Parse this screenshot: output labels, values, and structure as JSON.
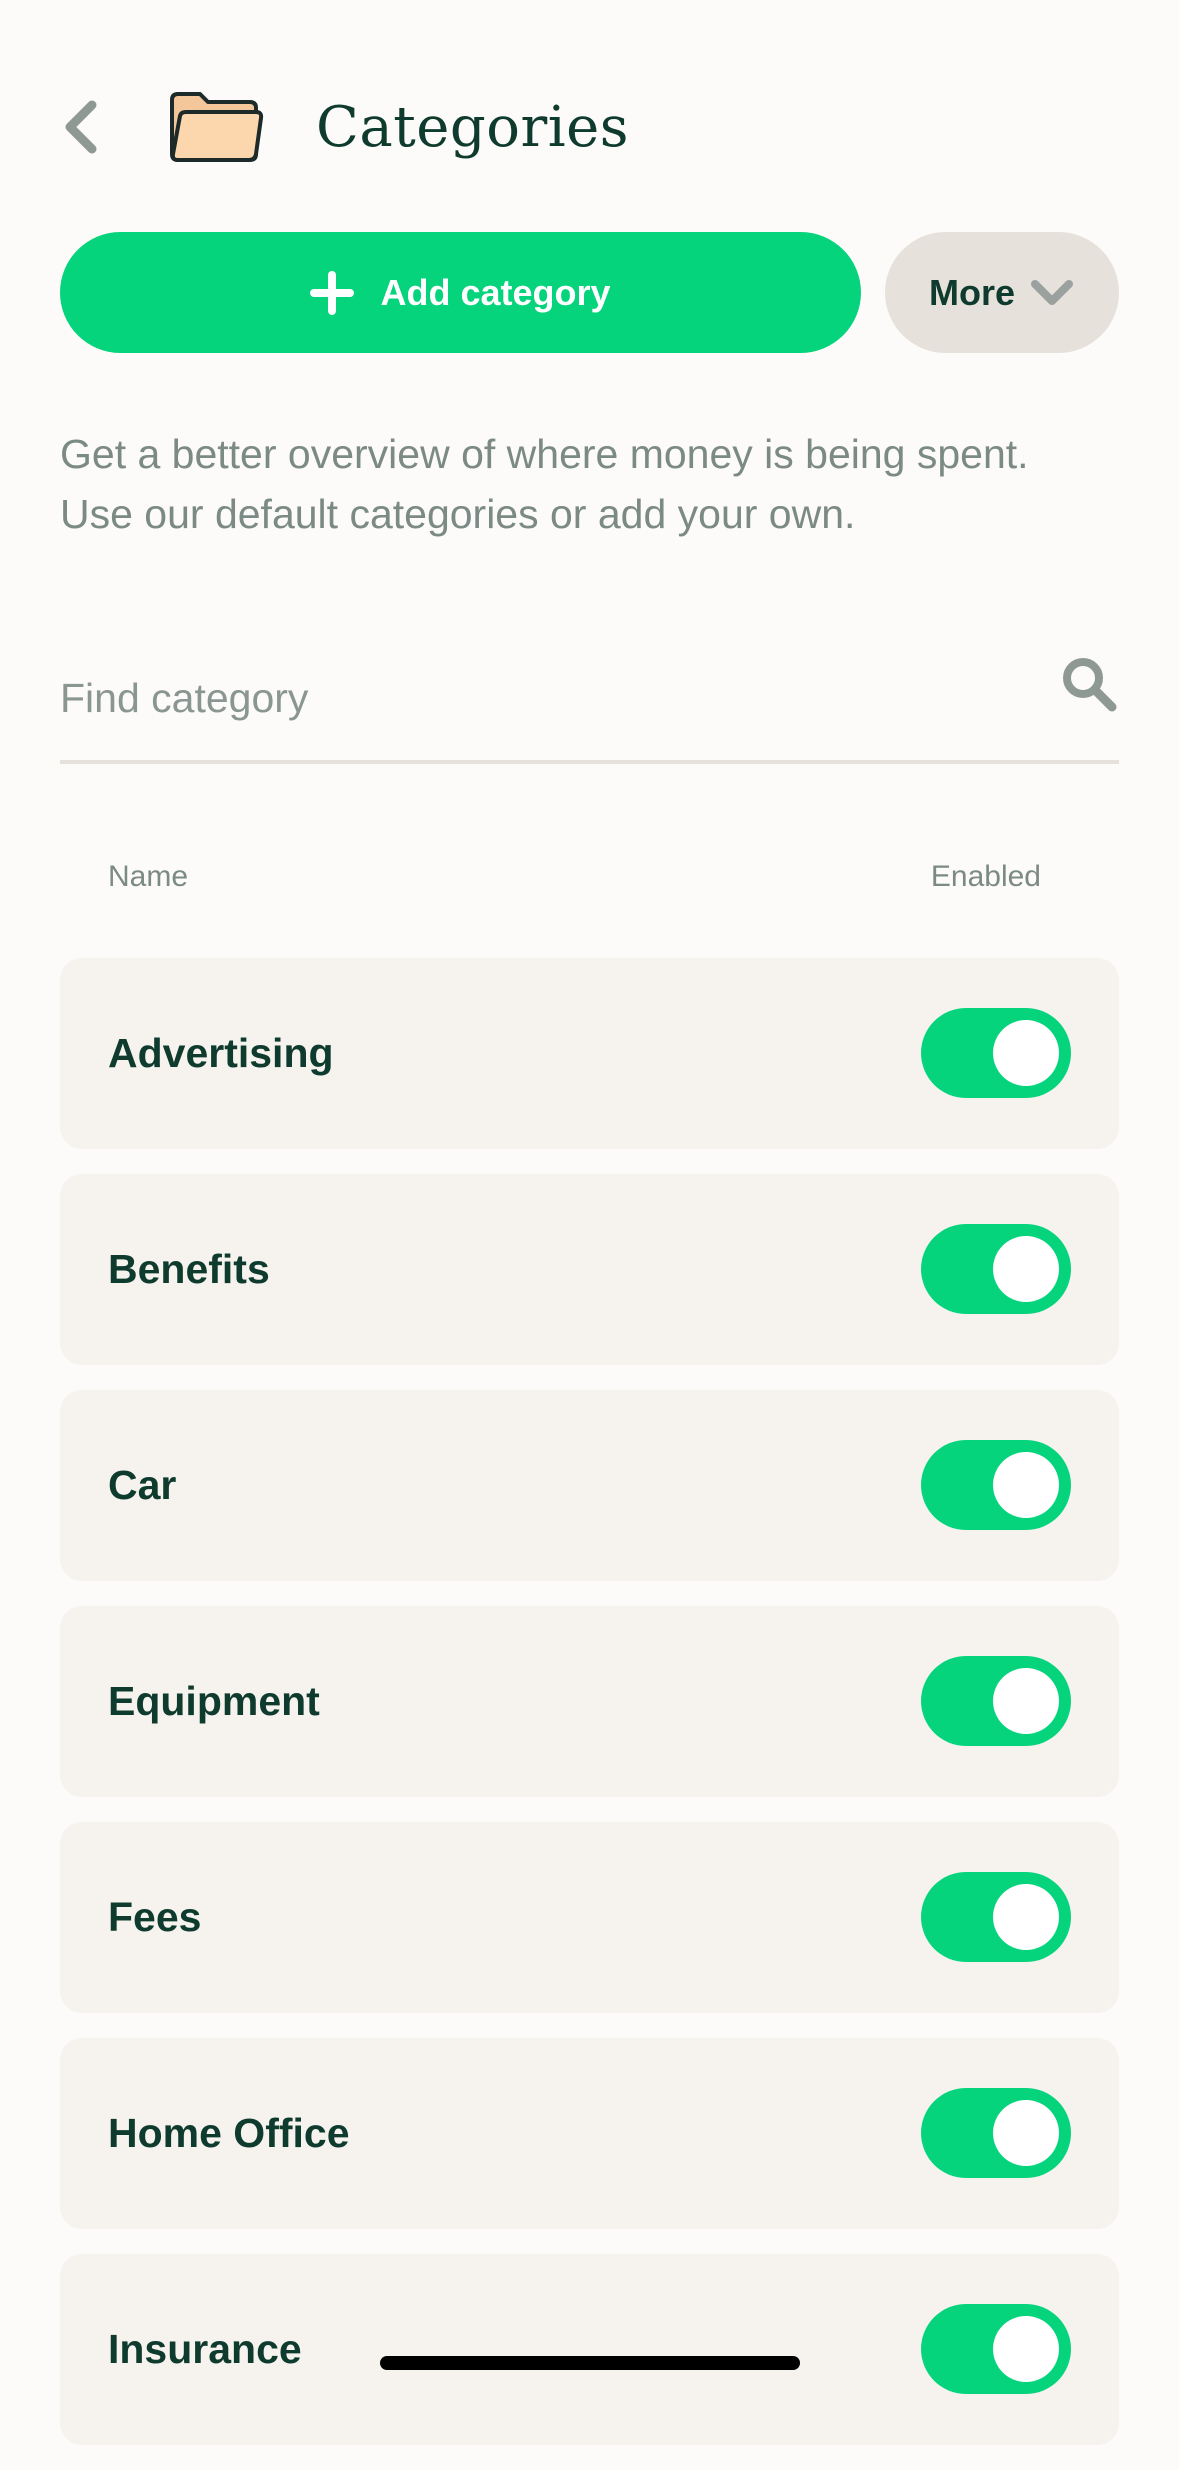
{
  "header": {
    "title": "Categories",
    "back_icon": "chevron-left-icon",
    "folder_icon": "folder-icon"
  },
  "actions": {
    "add_label": "Add category",
    "more_label": "More"
  },
  "description": {
    "line1": "Get a better overview of where money is being spent.",
    "line2": "Use our default categories or add your own."
  },
  "search": {
    "placeholder": "Find category",
    "value": ""
  },
  "columns": {
    "name": "Name",
    "enabled": "Enabled"
  },
  "categories": [
    {
      "name": "Advertising",
      "enabled": true
    },
    {
      "name": "Benefits",
      "enabled": true
    },
    {
      "name": "Car",
      "enabled": true
    },
    {
      "name": "Equipment",
      "enabled": true
    },
    {
      "name": "Fees",
      "enabled": true
    },
    {
      "name": "Home Office",
      "enabled": true
    },
    {
      "name": "Insurance",
      "enabled": true
    }
  ],
  "colors": {
    "accent": "#05d47c",
    "text_dark": "#0f3b2e",
    "text_muted": "#7c8a85",
    "row_bg": "#f6f3ef",
    "secondary_button": "#e6e1da"
  }
}
